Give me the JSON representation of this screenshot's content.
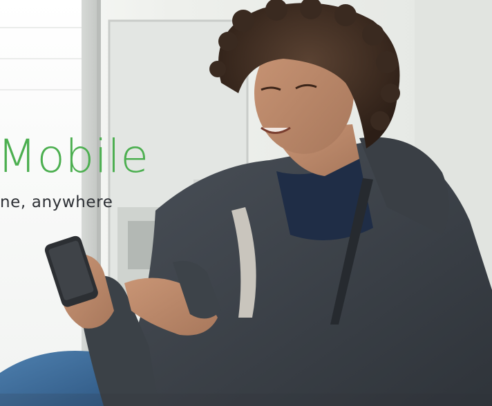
{
  "hero": {
    "headline": "Mobile",
    "subline": "ne, anywhere",
    "accent_color": "#4caf50",
    "text_color": "#2d3035"
  }
}
